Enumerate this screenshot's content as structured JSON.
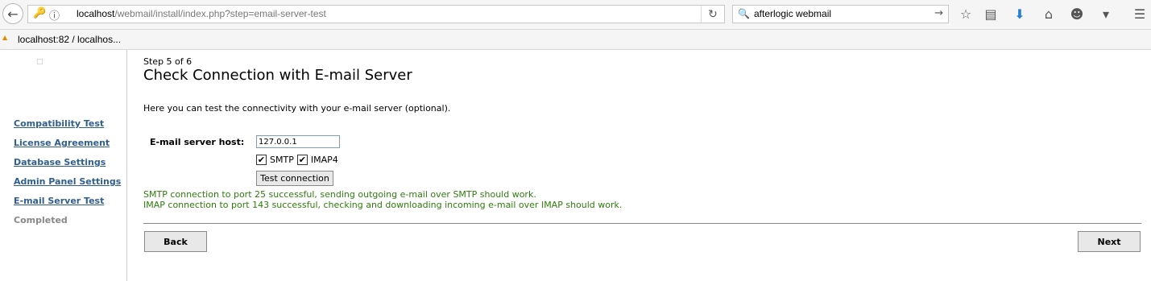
{
  "browser": {
    "url_host": "localhost",
    "url_path": "/webmail/install/index.php?step=email-server-test",
    "search_text": "afterlogic webmail",
    "bookmark_label": "localhost:82 / localhos..."
  },
  "sidebar": {
    "items": [
      {
        "label": "Compatibility Test",
        "state": "link"
      },
      {
        "label": "License Agreement",
        "state": "link"
      },
      {
        "label": "Database Settings",
        "state": "link"
      },
      {
        "label": "Admin Panel Settings",
        "state": "link"
      },
      {
        "label": "E-mail Server Test",
        "state": "link"
      },
      {
        "label": "Completed",
        "state": "inactive"
      }
    ]
  },
  "main": {
    "step": "Step 5 of 6",
    "title": "Check Connection with E-mail Server",
    "intro": "Here you can test the connectivity with your e-mail server (optional).",
    "host_label": "E-mail server host:",
    "host_value": "127.0.0.1",
    "smtp_label": "SMTP",
    "imap_label": "IMAP4",
    "smtp_checked": true,
    "imap_checked": true,
    "test_button": "Test connection",
    "result_smtp": "SMTP connection to port 25 successful, sending outgoing e-mail over SMTP should work.",
    "result_imap": "IMAP connection to port 143 successful, checking and downloading incoming e-mail over IMAP should work.",
    "back_button": "Back",
    "next_button": "Next"
  },
  "colors": {
    "link": "#2f5f91",
    "success": "#2e7d0c"
  }
}
